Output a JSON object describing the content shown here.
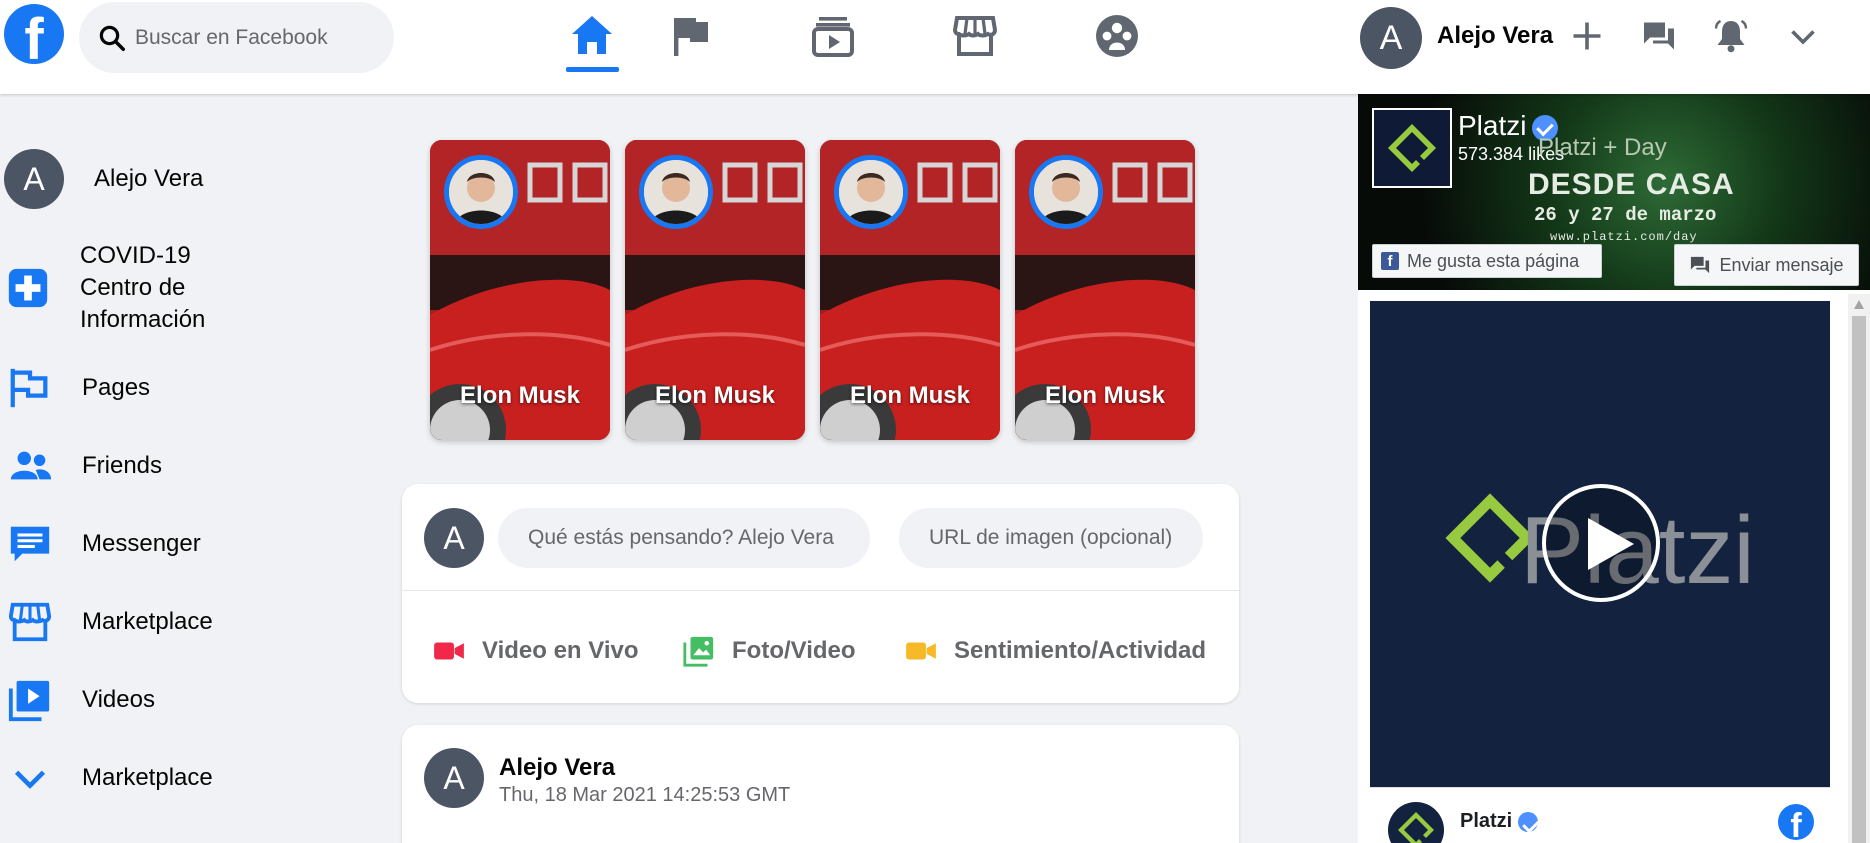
{
  "header": {
    "logo": "f",
    "search": {
      "placeholder": "Buscar en Facebook"
    },
    "nav_icons": [
      "home-icon",
      "flag-icon",
      "watch-icon",
      "marketplace-icon",
      "groups-icon"
    ],
    "user": {
      "initial": "A",
      "name": "Alejo Vera"
    },
    "right_icons": [
      "plus-icon",
      "messenger-icon",
      "bell-icon",
      "chevron-down-icon"
    ],
    "accent": "#1877f2"
  },
  "sidebar": {
    "profile": {
      "initial": "A",
      "name": "Alejo Vera"
    },
    "items": [
      {
        "label": "COVID-19 Centro de Información",
        "icon": "covid-plus-icon"
      },
      {
        "label": "Pages",
        "icon": "flag-icon"
      },
      {
        "label": "Friends",
        "icon": "friends-icon"
      },
      {
        "label": "Messenger",
        "icon": "messenger-icon"
      },
      {
        "label": "Marketplace",
        "icon": "marketplace-icon"
      },
      {
        "label": "Videos",
        "icon": "video-icon"
      },
      {
        "label": "Marketplace",
        "icon": "chevron-down-icon"
      }
    ]
  },
  "stories": [
    {
      "name": "Elon Musk"
    },
    {
      "name": "Elon Musk"
    },
    {
      "name": "Elon Musk"
    },
    {
      "name": "Elon Musk"
    }
  ],
  "composer": {
    "initial": "A",
    "text_placeholder": "Qué estás pensando? Alejo Vera",
    "url_placeholder": "URL de imagen (opcional)",
    "actions": [
      {
        "label": "Video en Vivo",
        "icon": "live-video-icon",
        "color": "#f02849"
      },
      {
        "label": "Foto/Video",
        "icon": "photo-icon",
        "color": "#45bd62"
      },
      {
        "label": "Sentimiento/Actividad",
        "icon": "feeling-camera-icon",
        "color": "#f7b928"
      }
    ]
  },
  "post": {
    "initial": "A",
    "author": "Alejo Vera",
    "timestamp": "Thu, 18 Mar 2021 14:25:53 GMT"
  },
  "page_widget": {
    "name": "Platzi",
    "likes": "573.384 likes",
    "cover": {
      "brand": "Platzi + Day",
      "title": "DESDE CASA",
      "date": "26 y 27 de marzo",
      "url": "www.platzi.com/day"
    },
    "like_button": "Me gusta esta página",
    "message_button": "Enviar mensaje",
    "video_word": "Platzi",
    "card_name": "Platzi"
  }
}
